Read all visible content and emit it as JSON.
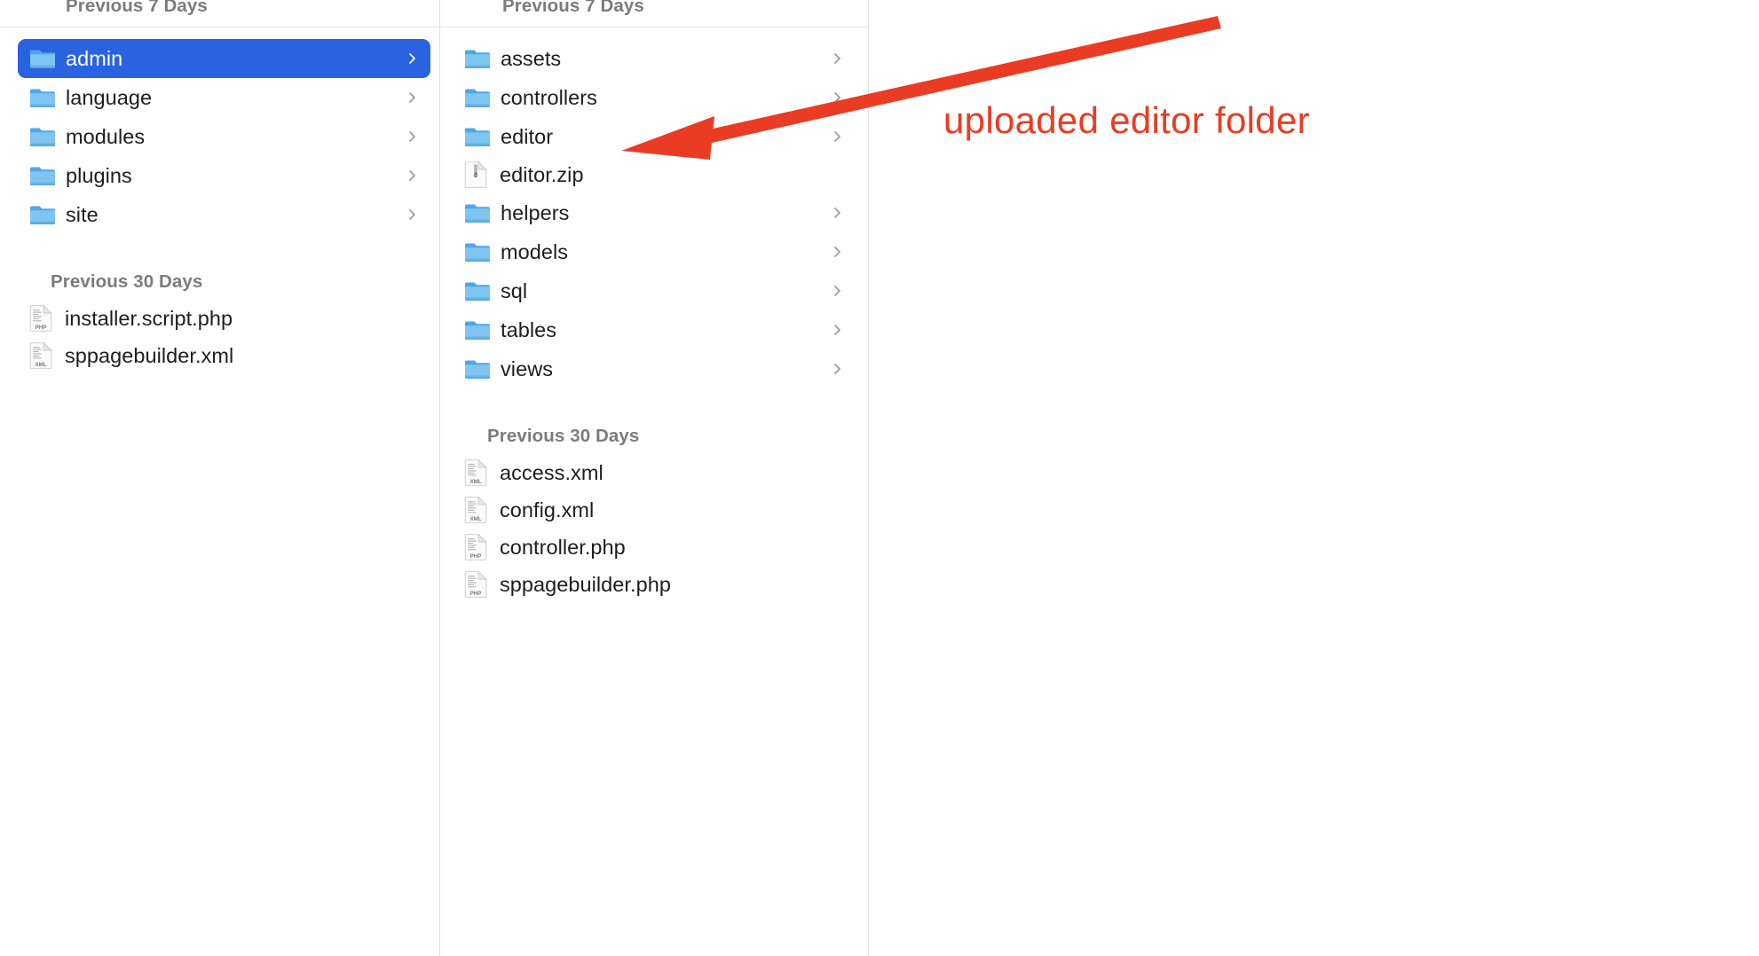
{
  "window": {
    "view": "column-view",
    "selection_color": "#2a63e0",
    "annotation_color": "#ea3c23",
    "header_text_color": "#7b7b7b",
    "item_text_color": "#1d1d1f"
  },
  "columns": [
    {
      "name": "column-1",
      "header": "Previous 7 Days",
      "sections": [
        {
          "heading": null,
          "items": [
            {
              "label": "admin",
              "kind": "folder",
              "icon": "folder-icon",
              "selected": true,
              "has_chevron": true
            },
            {
              "label": "language",
              "kind": "folder",
              "icon": "folder-icon",
              "selected": false,
              "has_chevron": true
            },
            {
              "label": "modules",
              "kind": "folder",
              "icon": "folder-icon",
              "selected": false,
              "has_chevron": true
            },
            {
              "label": "plugins",
              "kind": "folder",
              "icon": "folder-icon",
              "selected": false,
              "has_chevron": true
            },
            {
              "label": "site",
              "kind": "folder",
              "icon": "folder-icon",
              "selected": false,
              "has_chevron": true
            }
          ]
        },
        {
          "heading": "Previous 30 Days",
          "items": [
            {
              "label": "installer.script.php",
              "kind": "file",
              "icon": "php-file-icon",
              "badge": "PHP",
              "selected": false,
              "has_chevron": false
            },
            {
              "label": "sppagebuilder.xml",
              "kind": "file",
              "icon": "xml-file-icon",
              "badge": "XML",
              "selected": false,
              "has_chevron": false
            }
          ]
        }
      ]
    },
    {
      "name": "column-2",
      "header": "Previous 7 Days",
      "sections": [
        {
          "heading": null,
          "items": [
            {
              "label": "assets",
              "kind": "folder",
              "icon": "folder-icon",
              "selected": false,
              "has_chevron": true
            },
            {
              "label": "controllers",
              "kind": "folder",
              "icon": "folder-icon",
              "selected": false,
              "has_chevron": true
            },
            {
              "label": "editor",
              "kind": "folder",
              "icon": "folder-icon",
              "selected": false,
              "has_chevron": true
            },
            {
              "label": "editor.zip",
              "kind": "file",
              "icon": "zip-file-icon",
              "badge": "",
              "selected": false,
              "has_chevron": false
            },
            {
              "label": "helpers",
              "kind": "folder",
              "icon": "folder-icon",
              "selected": false,
              "has_chevron": true
            },
            {
              "label": "models",
              "kind": "folder",
              "icon": "folder-icon",
              "selected": false,
              "has_chevron": true
            },
            {
              "label": "sql",
              "kind": "folder",
              "icon": "folder-icon",
              "selected": false,
              "has_chevron": true
            },
            {
              "label": "tables",
              "kind": "folder",
              "icon": "folder-icon",
              "selected": false,
              "has_chevron": true
            },
            {
              "label": "views",
              "kind": "folder",
              "icon": "folder-icon",
              "selected": false,
              "has_chevron": true
            }
          ]
        },
        {
          "heading": "Previous 30 Days",
          "items": [
            {
              "label": "access.xml",
              "kind": "file",
              "icon": "xml-file-icon",
              "badge": "XML",
              "selected": false,
              "has_chevron": false
            },
            {
              "label": "config.xml",
              "kind": "file",
              "icon": "xml-file-icon",
              "badge": "XML",
              "selected": false,
              "has_chevron": false
            },
            {
              "label": "controller.php",
              "kind": "file",
              "icon": "php-file-icon",
              "badge": "PHP",
              "selected": false,
              "has_chevron": false
            },
            {
              "label": "sppagebuilder.php",
              "kind": "file",
              "icon": "php-file-icon",
              "badge": "PHP",
              "selected": false,
              "has_chevron": false
            }
          ]
        }
      ]
    },
    {
      "name": "column-3",
      "header": "",
      "sections": []
    }
  ],
  "annotation": {
    "text": "uploaded editor folder",
    "arrow": "red-arrow-pointing-to-editor-folder",
    "color": "#ea3c23"
  }
}
